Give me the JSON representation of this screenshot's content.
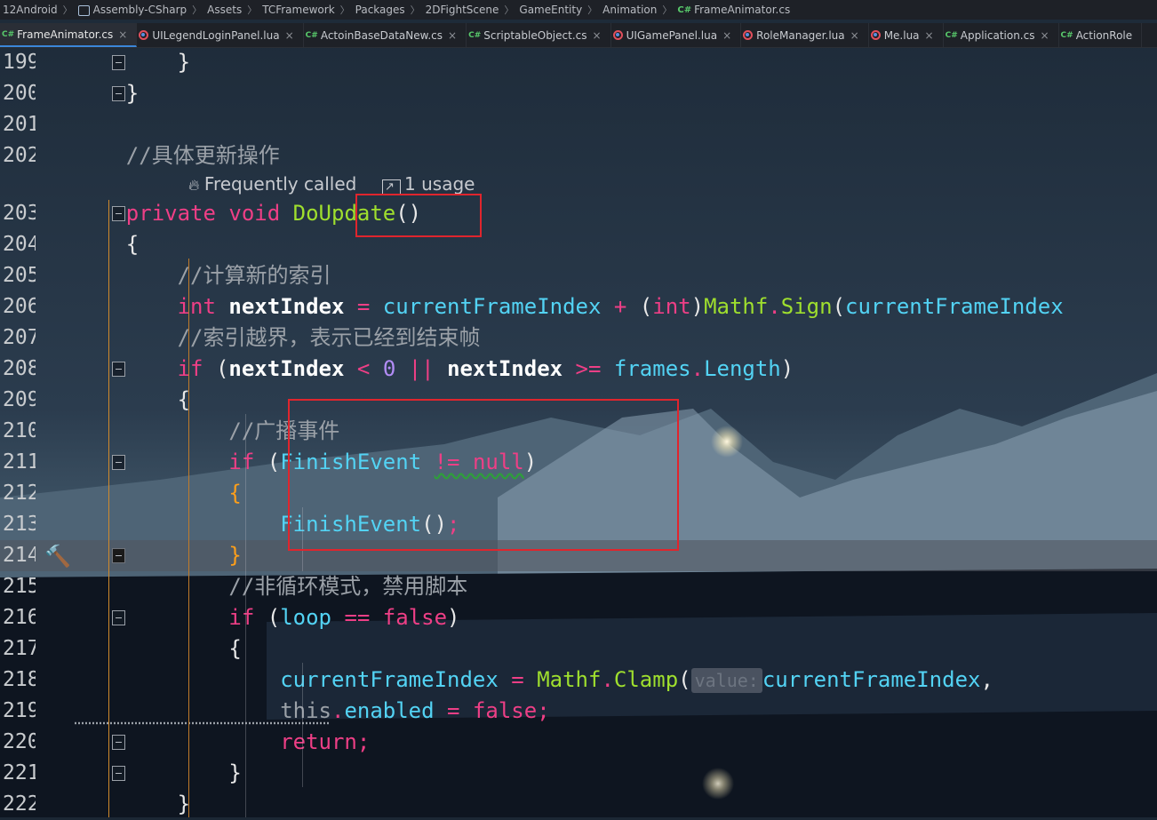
{
  "breadcrumb": [
    {
      "label": "12Android",
      "icon": ""
    },
    {
      "label": "Assembly-CSharp",
      "icon": "project"
    },
    {
      "label": "Assets",
      "icon": ""
    },
    {
      "label": "TCFramework",
      "icon": ""
    },
    {
      "label": "Packages",
      "icon": ""
    },
    {
      "label": "2DFightScene",
      "icon": ""
    },
    {
      "label": "GameEntity",
      "icon": ""
    },
    {
      "label": "Animation",
      "icon": ""
    },
    {
      "label": "FrameAnimator.cs",
      "icon": "cs"
    }
  ],
  "cs_badge": "C#",
  "tab_close": "×",
  "tabs": [
    {
      "label": "FrameAnimator.cs",
      "kind": "cs",
      "active": true
    },
    {
      "label": "UILegendLoginPanel.lua",
      "kind": "lua",
      "active": false
    },
    {
      "label": "ActoinBaseDataNew.cs",
      "kind": "cs",
      "active": false
    },
    {
      "label": "ScriptableObject.cs",
      "kind": "cs",
      "active": false
    },
    {
      "label": "UIGamePanel.lua",
      "kind": "lua",
      "active": false
    },
    {
      "label": "RoleManager.lua",
      "kind": "lua",
      "active": false
    },
    {
      "label": "Me.lua",
      "kind": "lua",
      "active": false
    },
    {
      "label": "Application.cs",
      "kind": "cs",
      "active": false
    },
    {
      "label": "ActionRole",
      "kind": "cs",
      "active": false
    }
  ],
  "editor": {
    "hint": {
      "frequent": "Frequently called",
      "usage": "1 usage"
    },
    "lines": [
      {
        "no": "199",
        "tokens": [
          [
            "plain",
            "        }"
          ]
        ]
      },
      {
        "no": "200",
        "tokens": [
          [
            "plain",
            "    }"
          ]
        ]
      },
      {
        "no": "201",
        "tokens": []
      },
      {
        "no": "202",
        "tokens": [
          [
            "cm",
            "    //具体更新操作"
          ]
        ]
      },
      {
        "no": "203",
        "tokens": [
          [
            "kw",
            "    private void "
          ],
          [
            "fn",
            "DoUpdate"
          ],
          [
            "plain",
            "()"
          ]
        ]
      },
      {
        "no": "204",
        "tokens": [
          [
            "plain",
            "    {"
          ]
        ]
      },
      {
        "no": "205",
        "tokens": [
          [
            "cm",
            "        //计算新的索引"
          ]
        ]
      },
      {
        "no": "206",
        "tokens": [
          [
            "kw",
            "        int "
          ],
          [
            "bold-id",
            "nextIndex"
          ],
          [
            "op",
            " = "
          ],
          [
            "id",
            "currentFrameIndex"
          ],
          [
            "op",
            " + "
          ],
          [
            "plain",
            "("
          ],
          [
            "kw",
            "int"
          ],
          [
            "plain",
            ")"
          ],
          [
            "fn",
            "Mathf"
          ],
          [
            "op",
            "."
          ],
          [
            "fn",
            "Sign"
          ],
          [
            "plain",
            "("
          ],
          [
            "id",
            "currentFrameIndex"
          ]
        ]
      },
      {
        "no": "207",
        "tokens": [
          [
            "cm",
            "        //索引越界，表示已经到结束帧"
          ]
        ]
      },
      {
        "no": "208",
        "tokens": [
          [
            "kw",
            "        if "
          ],
          [
            "plain",
            "("
          ],
          [
            "bold-id",
            "nextIndex"
          ],
          [
            "op",
            " < "
          ],
          [
            "num",
            "0"
          ],
          [
            "op",
            " || "
          ],
          [
            "bold-id",
            "nextIndex"
          ],
          [
            "op",
            " >= "
          ],
          [
            "id",
            "frames"
          ],
          [
            "op",
            "."
          ],
          [
            "id",
            "Length"
          ],
          [
            "plain",
            ")"
          ]
        ]
      },
      {
        "no": "209",
        "tokens": [
          [
            "plain",
            "        {"
          ]
        ]
      },
      {
        "no": "210",
        "tokens": [
          [
            "cm",
            "            //广播事件"
          ]
        ]
      },
      {
        "no": "211",
        "tokens": [
          [
            "kw",
            "            if "
          ],
          [
            "plain",
            "("
          ],
          [
            "id",
            "FinishEvent"
          ],
          [
            "op",
            " "
          ],
          [
            "op wavy",
            "!= null"
          ],
          [
            "plain",
            ")"
          ]
        ]
      },
      {
        "no": "212",
        "tokens": [
          [
            "amber",
            "            {"
          ]
        ]
      },
      {
        "no": "213",
        "tokens": [
          [
            "id",
            "                FinishEvent"
          ],
          [
            "plain",
            "()"
          ],
          [
            "op",
            ";"
          ]
        ]
      },
      {
        "no": "214",
        "tokens": [
          [
            "amber",
            "            }"
          ]
        ]
      },
      {
        "no": "215",
        "tokens": [
          [
            "cm",
            "            //非循环模式，禁用脚本"
          ]
        ]
      },
      {
        "no": "216",
        "tokens": [
          [
            "kw",
            "            if "
          ],
          [
            "plain",
            "("
          ],
          [
            "id",
            "loop"
          ],
          [
            "op",
            " == "
          ],
          [
            "kw",
            "false"
          ],
          [
            "plain",
            ")"
          ]
        ]
      },
      {
        "no": "217",
        "tokens": [
          [
            "plain",
            "            {"
          ]
        ]
      },
      {
        "no": "218",
        "tokens": [
          [
            "id",
            "                currentFrameIndex"
          ],
          [
            "op",
            " = "
          ],
          [
            "fn",
            "Mathf"
          ],
          [
            "op",
            "."
          ],
          [
            "fn",
            "Clamp"
          ],
          [
            "plain",
            "("
          ],
          [
            "hint-param",
            "value:"
          ],
          [
            "id",
            "currentFrameIndex"
          ],
          [
            "plain",
            ","
          ]
        ]
      },
      {
        "no": "219",
        "tokens": [
          [
            "cm uline-dots",
            "                this"
          ],
          [
            "op",
            "."
          ],
          [
            "id",
            "enabled"
          ],
          [
            "op",
            " = "
          ],
          [
            "kw",
            "false"
          ],
          [
            "op",
            ";"
          ]
        ]
      },
      {
        "no": "220",
        "tokens": [
          [
            "kw",
            "                return"
          ],
          [
            "op",
            ";"
          ]
        ]
      },
      {
        "no": "221",
        "tokens": [
          [
            "plain",
            "            }"
          ]
        ]
      },
      {
        "no": "222",
        "tokens": [
          [
            "plain",
            "        }"
          ]
        ]
      }
    ]
  }
}
